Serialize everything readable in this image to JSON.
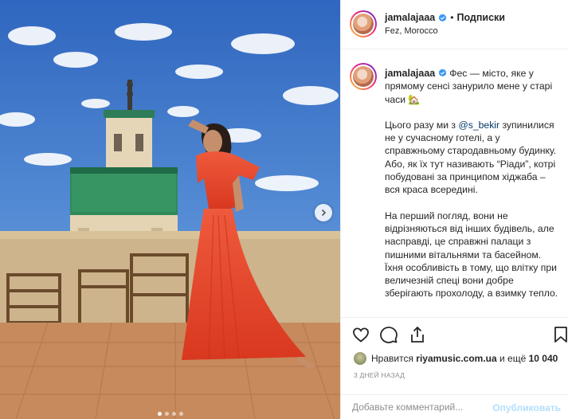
{
  "post": {
    "username": "jamalajaaa",
    "follow_label": "Подписки",
    "separator": "•",
    "location": "Fez, Morocco"
  },
  "caption": {
    "username": "jamalajaaa",
    "p1_text": "Фес — місто, яке у прямому сенсі занурило мене у старі часи 🏡",
    "p2_before": "Цього разу ми з ",
    "p2_mention": "@s_bekir",
    "p2_after": " зупинилися не у сучасному готелі, а у справжньому стародавньому будинку. Або, як їх тут називають “Ріади”, котрі побудовані за принципом хіджаба – вся краса всередині.",
    "p3_text": "На перший погляд, вони не відрізняються від інших будівель, але насправді, це справжні палаци з пишними вітальнями та басейном. Їхня особливість в тому, що влітку при величезній спеці вони добре зберігають прохолоду, а взимку тепло."
  },
  "likes": {
    "prefix": "Нравится ",
    "liker": "riyamusic.com.ua",
    "middle": " и ещё ",
    "count": "10 040"
  },
  "timeago": "3 дней назад",
  "comment": {
    "placeholder": "Добавьте комментарий...",
    "publish_label": "Опубликовать"
  },
  "carousel": {
    "current_index": 1,
    "total": 4
  },
  "icons": {
    "verified": "verified-badge-icon",
    "next": "chevron-right-icon",
    "like": "heart-icon",
    "comment": "comment-bubble-icon",
    "share": "share-icon",
    "save": "bookmark-icon"
  },
  "colors": {
    "verified": "#3897f0",
    "mention": "#00376b",
    "publish_disabled": "#b2dffc",
    "dress": "#e8442a",
    "sky": "#3f78c9"
  }
}
